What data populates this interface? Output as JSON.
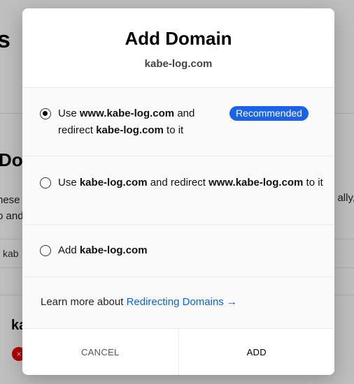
{
  "background": {
    "title_fragment": "s",
    "heading_fragment": "Do",
    "text_left_1": "hese",
    "text_left_2": "o and",
    "text_right": "ally,",
    "row_text": "kab",
    "card_title": "ka",
    "error_icon": "×"
  },
  "modal": {
    "title": "Add Domain",
    "subtitle": "kabe-log.com",
    "options": [
      {
        "pre": "Use ",
        "b1": "www.kabe-log.com",
        "mid": " and redirect ",
        "b2": "kabe-log.com",
        "post": " to it",
        "checked": true
      },
      {
        "pre": "Use ",
        "b1": "kabe-log.com",
        "mid": " and redirect ",
        "b2": "www.kabe-log.com",
        "post": " to it",
        "checked": false
      },
      {
        "pre": "Add ",
        "b1": "kabe-log.com",
        "checked": false
      }
    ],
    "recommended_badge": "Recommended",
    "learn_prefix": "Learn more about ",
    "learn_link": "Redirecting Domains →",
    "cancel_label": "CANCEL",
    "add_label": "ADD"
  },
  "colors": {
    "accent": "#1a62e6",
    "link": "#0a63d8"
  }
}
